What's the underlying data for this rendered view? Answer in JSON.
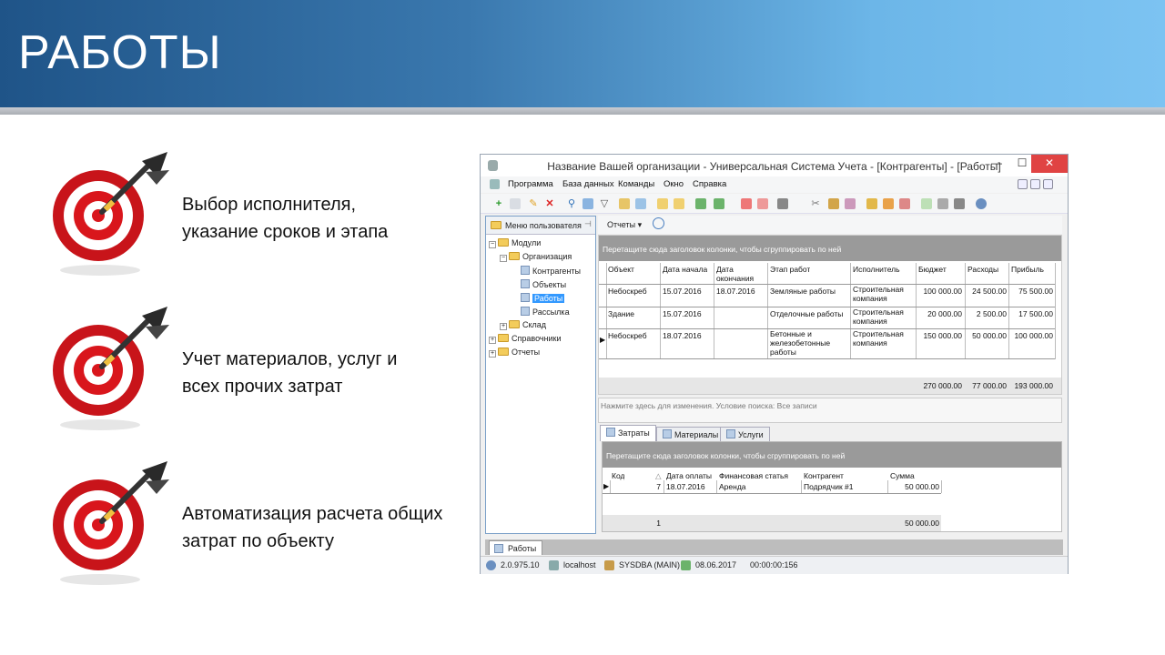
{
  "slide": {
    "title": "РАБОТЫ"
  },
  "bullets": [
    {
      "line1": "Выбор исполнителя,",
      "line2": "указание сроков и этапа"
    },
    {
      "line1": "Учет материалов, услуг и",
      "line2": "всех прочих затрат"
    },
    {
      "line1": "Автоматизация расчета общих",
      "line2": "затрат по объекту"
    }
  ],
  "window": {
    "title": "Название Вашей организации - Универсальная Система Учета - [Контрагенты] - [Работы]",
    "controls": {
      "minimize": "—",
      "maximize": "☐",
      "close": "✕"
    },
    "menu": [
      "Программа",
      "База данных",
      "Команды",
      "Окно",
      "Справка"
    ],
    "user_menu_label": "Меню пользователя",
    "tree": {
      "modules": "Модули",
      "organization": "Организация",
      "contractors": "Контрагенты",
      "objects": "Объекты",
      "works": "Работы",
      "mailing": "Рассылка",
      "warehouse": "Склад",
      "references": "Справочники",
      "reports": "Отчеты"
    },
    "reports_button": "Отчеты",
    "group_hint": "Перетащите сюда заголовок колонки, чтобы сгруппировать по ней",
    "works_grid": {
      "headers": [
        "Объект",
        "Дата начала",
        "Дата окончания",
        "Этап работ",
        "Исполнитель",
        "Бюджет",
        "Расходы",
        "Прибыль"
      ],
      "rows": [
        [
          "Небоскреб",
          "15.07.2016",
          "18.07.2016",
          "Земляные работы",
          "Строительная компания",
          "100 000.00",
          "24 500.00",
          "75 500.00"
        ],
        [
          "Здание",
          "15.07.2016",
          "",
          "Отделочные работы",
          "Строительная компания",
          "20 000.00",
          "2 500.00",
          "17 500.00"
        ],
        [
          "Небоскреб",
          "18.07.2016",
          "",
          "Бетонные и железобетонные работы",
          "Строительная компания",
          "150 000.00",
          "50 000.00",
          "100 000.00"
        ]
      ],
      "totals": [
        "270 000.00",
        "77 000.00",
        "193 000.00"
      ]
    },
    "filter_text": "Нажмите здесь для изменения. Условие поиска: Все записи",
    "tabs": [
      "Затраты",
      "Материалы",
      "Услуги"
    ],
    "costs_grid": {
      "headers": [
        "Код",
        "Дата оплаты",
        "Финансовая статья",
        "Контрагент",
        "Сумма"
      ],
      "rows": [
        [
          "7",
          "18.07.2016",
          "Аренда",
          "Подрядчик #1",
          "50 000.00"
        ]
      ],
      "footer_count": "1",
      "footer_sum": "50 000.00"
    },
    "doc_tab": "Работы",
    "status": {
      "version": "2.0.975.10",
      "host": "localhost",
      "db_user": "SYSDBA (MAIN)",
      "date": "08.06.2017",
      "timer": "00:00:00:156"
    }
  }
}
